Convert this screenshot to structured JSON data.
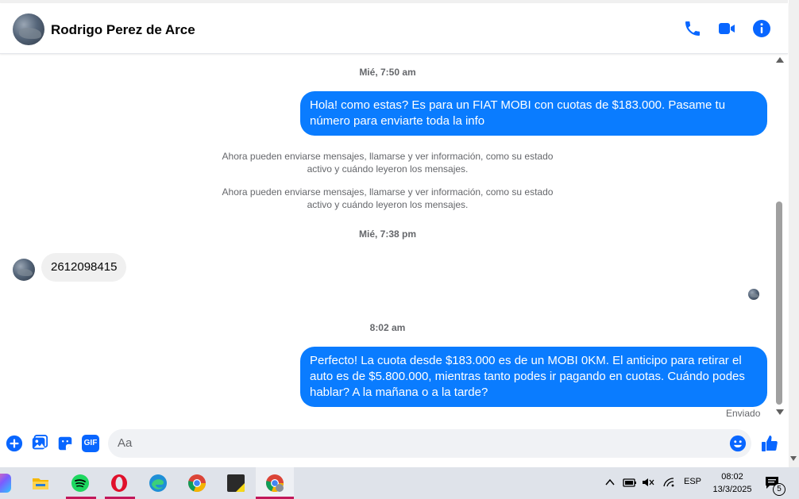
{
  "header": {
    "contact_name": "Rodrigo Perez de Arce",
    "icons": [
      "phone-icon",
      "video-call-icon",
      "info-icon"
    ]
  },
  "messages": {
    "ts1": "Mié, 7:50 am",
    "out1": "Hola! como estas? Es para un FIAT MOBI con cuotas de $183.000. Pasame tu número para enviarte toda la info",
    "sys1": "Ahora pueden enviarse mensajes, llamarse y ver información, como su estado activo y cuándo leyeron los mensajes.",
    "sys2": "Ahora pueden enviarse mensajes, llamarse y ver información, como su estado activo y cuándo leyeron los mensajes.",
    "ts2": "Mié, 7:38 pm",
    "in1": "2612098415",
    "ts3": "8:02 am",
    "out2": "Perfecto! La cuota desde $183.000 es de un MOBI 0KM. El anticipo para retirar el auto es de $5.800.000, mientras tanto podes ir pagando en cuotas. Cuándo podes hablar? A la mañana o a la tarde?",
    "status": "Enviado"
  },
  "composer": {
    "placeholder": "Aa",
    "icons": [
      "plus-icon",
      "image-icon",
      "sticker-icon",
      "gif-icon",
      "emoji-icon",
      "like-icon"
    ],
    "gif_label": "GIF"
  },
  "taskbar": {
    "lang": "ESP",
    "time": "08:02",
    "date": "13/3/2025",
    "notif_count": "5"
  },
  "colors": {
    "accent": "#0a7cff",
    "icon_blue": "#0866ff"
  }
}
